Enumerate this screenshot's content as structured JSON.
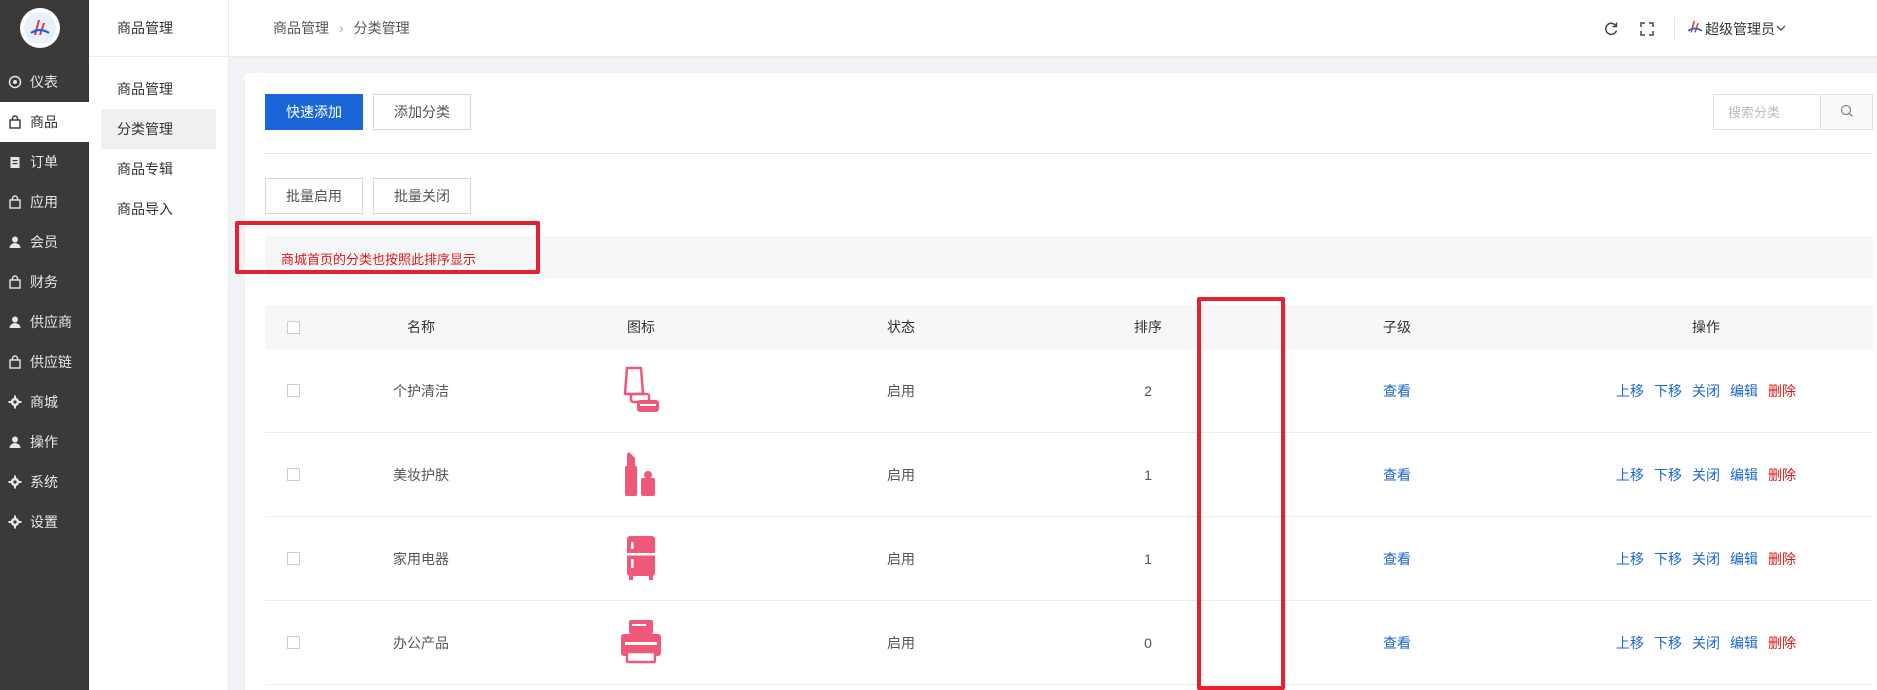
{
  "sidebar": {
    "items": [
      {
        "label": "仪表",
        "icon": "dashboard-icon"
      },
      {
        "label": "商品",
        "icon": "bag-icon"
      },
      {
        "label": "订单",
        "icon": "clipboard-icon"
      },
      {
        "label": "应用",
        "icon": "bag-icon"
      },
      {
        "label": "会员",
        "icon": "user-icon"
      },
      {
        "label": "财务",
        "icon": "bag-icon"
      },
      {
        "label": "供应商",
        "icon": "user-icon"
      },
      {
        "label": "供应链",
        "icon": "bag-icon"
      },
      {
        "label": "商城",
        "icon": "gear-icon"
      },
      {
        "label": "操作",
        "icon": "user-icon"
      },
      {
        "label": "系统",
        "icon": "gear-icon"
      },
      {
        "label": "设置",
        "icon": "gear-icon"
      }
    ]
  },
  "subbar": {
    "title": "商品管理",
    "items": [
      "商品管理",
      "分类管理",
      "商品专辑",
      "商品导入"
    ]
  },
  "header": {
    "breadcrumb": [
      "商品管理",
      "分类管理"
    ],
    "user": "超级管理员"
  },
  "toolbar": {
    "quick_add": "快速添加",
    "add_category": "添加分类",
    "search_placeholder": "搜索分类",
    "batch_enable": "批量启用",
    "batch_close": "批量关闭"
  },
  "tip": "商城首页的分类也按照此排序显示",
  "table": {
    "headers": [
      "名称",
      "图标",
      "状态",
      "排序",
      "子级",
      "操作"
    ],
    "rows": [
      {
        "name": "个护清洁",
        "icon": "lotion-icon",
        "status": "启用",
        "sort": "2",
        "child": "查看"
      },
      {
        "name": "美妆护肤",
        "icon": "lipstick-icon",
        "status": "启用",
        "sort": "1",
        "child": "查看"
      },
      {
        "name": "家用电器",
        "icon": "fridge-icon",
        "status": "启用",
        "sort": "1",
        "child": "查看"
      },
      {
        "name": "办公产品",
        "icon": "printer-icon",
        "status": "启用",
        "sort": "0",
        "child": "查看"
      }
    ],
    "ops": {
      "up": "上移",
      "down": "下移",
      "close": "关闭",
      "edit": "编辑",
      "delete": "删除"
    }
  },
  "colors": {
    "primary": "#1a66d9",
    "danger": "#e01717",
    "sidebar": "#3a3a3a",
    "icon_pink": "#f0587a",
    "highlight": "#e32131"
  }
}
